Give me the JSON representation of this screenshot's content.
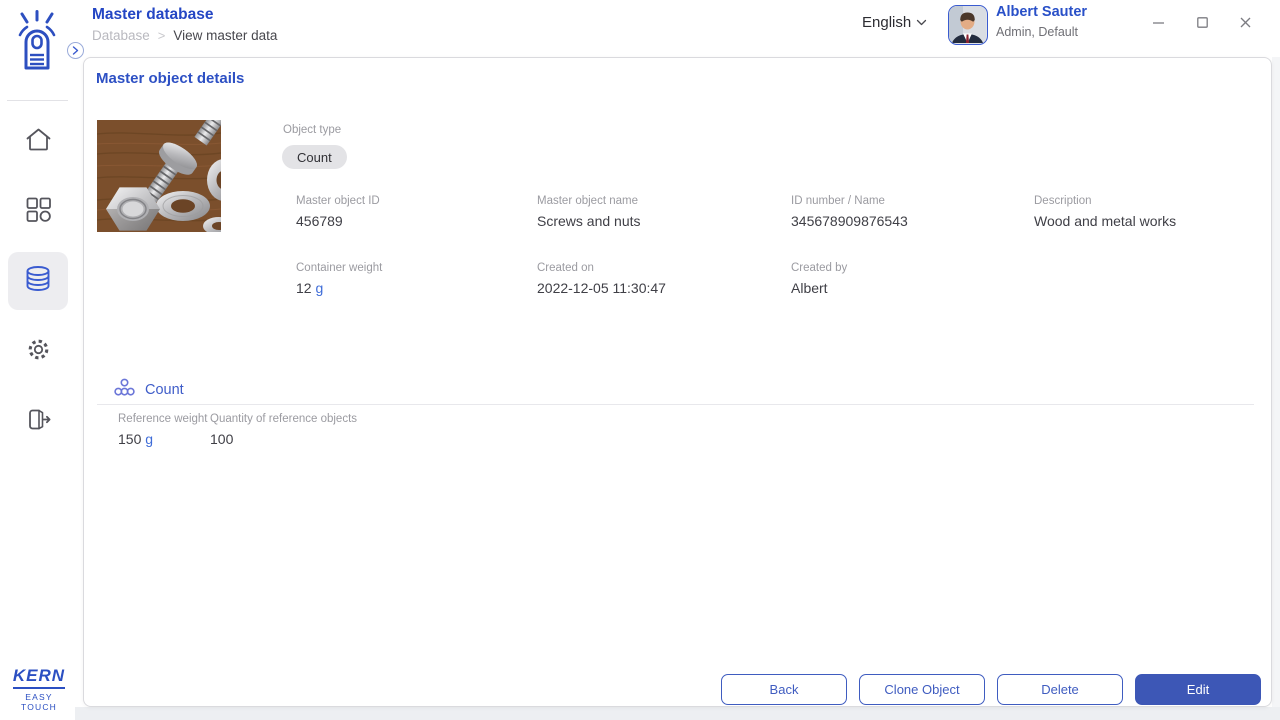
{
  "header": {
    "title": "Master database",
    "breadcrumb": {
      "parent": "Database",
      "separator": ">",
      "current": "View master data"
    },
    "language": "English",
    "user": {
      "name": "Albert Sauter",
      "role": "Admin, Default"
    }
  },
  "sidebar": {
    "active_item": "database",
    "items": [
      {
        "id": "home",
        "icon": "home-icon"
      },
      {
        "id": "apps",
        "icon": "apps-grid-icon"
      },
      {
        "id": "database",
        "icon": "database-icon"
      },
      {
        "id": "settings",
        "icon": "gear-icon"
      },
      {
        "id": "logout",
        "icon": "logout-icon"
      }
    ],
    "logo": {
      "brand": "KERN",
      "product": "EASY TOUCH"
    }
  },
  "main": {
    "heading": "Master object details",
    "object_type": {
      "label": "Object type",
      "value": "Count"
    },
    "fields": [
      {
        "label": "Master object ID",
        "value": "456789"
      },
      {
        "label": "Master object name",
        "value": "Screws and nuts"
      },
      {
        "label": "ID number / Name",
        "value": "345678909876543"
      },
      {
        "label": "Description",
        "value": "Wood and metal works"
      },
      {
        "label": "Container weight",
        "value": "12",
        "unit": "g"
      },
      {
        "label": "Created on",
        "value": "2022-12-05 11:30:47"
      },
      {
        "label": "Created by",
        "value": "Albert"
      }
    ],
    "count_section": {
      "title": "Count",
      "icon": "count-circles-icon",
      "fields": [
        {
          "label": "Reference weight",
          "value": "150",
          "unit": "g"
        },
        {
          "label": "Quantity of reference objects",
          "value": "100"
        }
      ]
    },
    "buttons": [
      {
        "label": "Back",
        "style": "outline"
      },
      {
        "label": "Clone Object",
        "style": "outline"
      },
      {
        "label": "Delete",
        "style": "outline"
      },
      {
        "label": "Edit",
        "style": "primary"
      }
    ]
  },
  "colors": {
    "primary_blue": "#2d50c4",
    "button_fill": "#3d57b6",
    "label_gray": "#9b9ba1",
    "value_dark": "#3f3f46",
    "unit_blue": "#3e6cd8"
  }
}
